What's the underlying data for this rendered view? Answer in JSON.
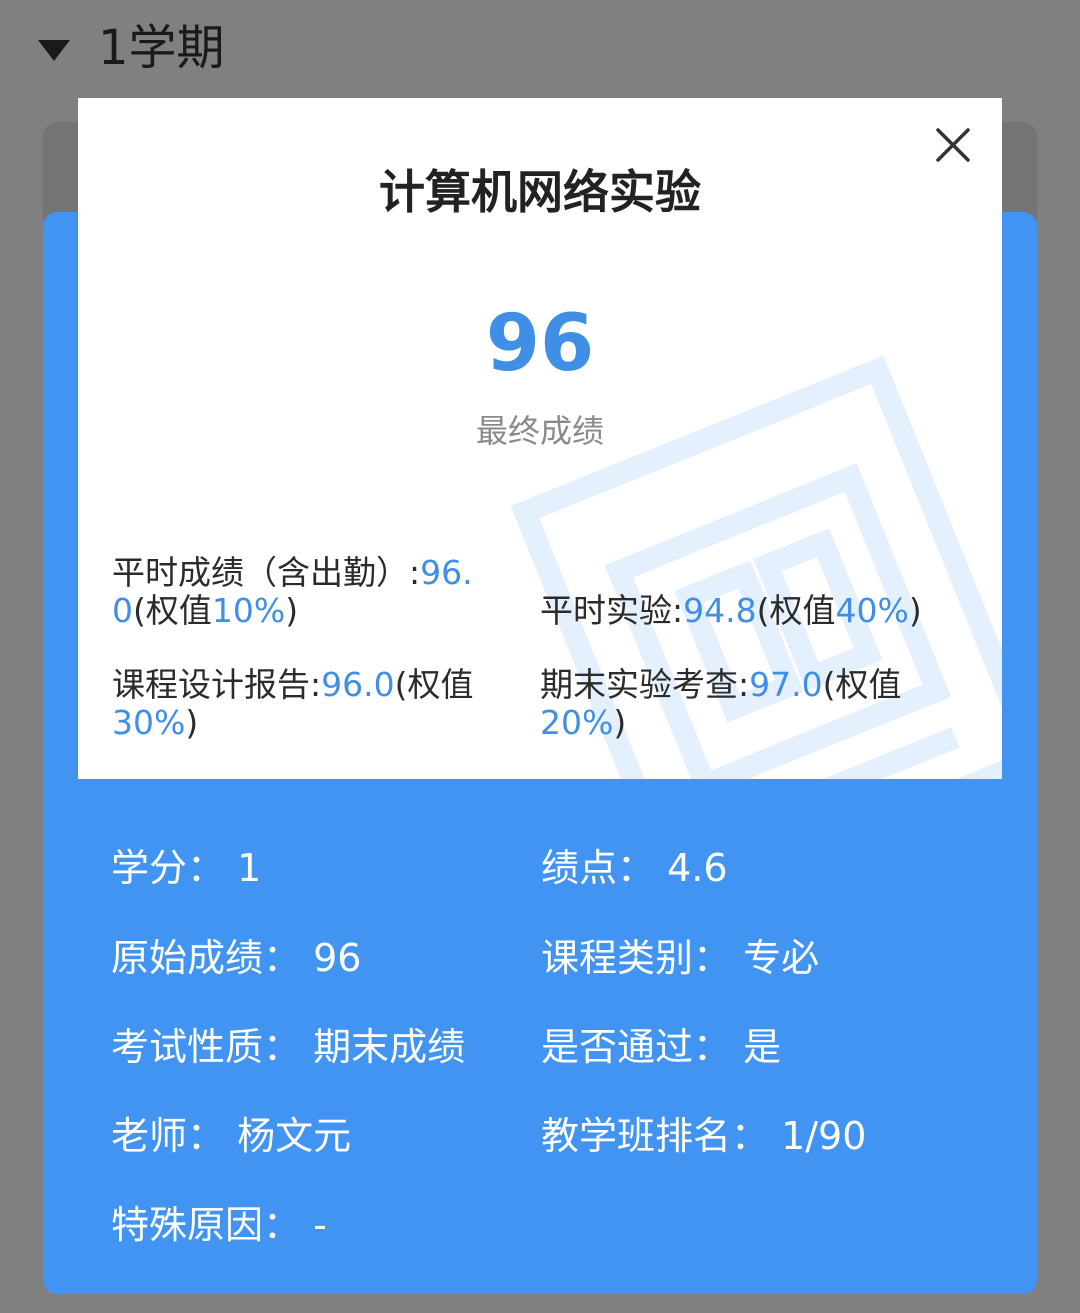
{
  "semester": {
    "label": "1学期"
  },
  "modal": {
    "title": "计算机网络实验",
    "final_score": "96",
    "final_label": "最终成绩",
    "components": [
      {
        "name": "平时成绩（含出勤）:",
        "score": "96.0",
        "weight_prefix": "(权值",
        "weight": "10%",
        "weight_suffix": ")"
      },
      {
        "name": "平时实验:",
        "score": "94.8",
        "weight_prefix": "(权值",
        "weight": "40%",
        "weight_suffix": ")"
      },
      {
        "name": "课程设计报告:",
        "score": "96.0",
        "weight_prefix": "(权值",
        "weight": "30%",
        "weight_suffix": ")"
      },
      {
        "name": "期末实验考查:",
        "score": "97.0",
        "weight_prefix": "(权值",
        "weight": "20%",
        "weight_suffix": ")"
      }
    ]
  },
  "details": {
    "credit": "学分：  1",
    "gpa": "绩点：  4.6",
    "raw_score": "原始成绩：  96",
    "course_type": "课程类别：  专必",
    "exam_nature": "考试性质：  期末成绩",
    "passed": "是否通过：  是",
    "teacher": "老师：  杨文元",
    "class_rank": "教学班排名：  1/90",
    "special_reason": "特殊原因：  -"
  },
  "colors": {
    "accent": "#3f8fe6",
    "card_blue": "#4294f2",
    "overlay": "#808080"
  },
  "icons": {
    "caret": "caret-down-icon",
    "close": "close-icon",
    "watermark": "score-stamp-watermark"
  }
}
